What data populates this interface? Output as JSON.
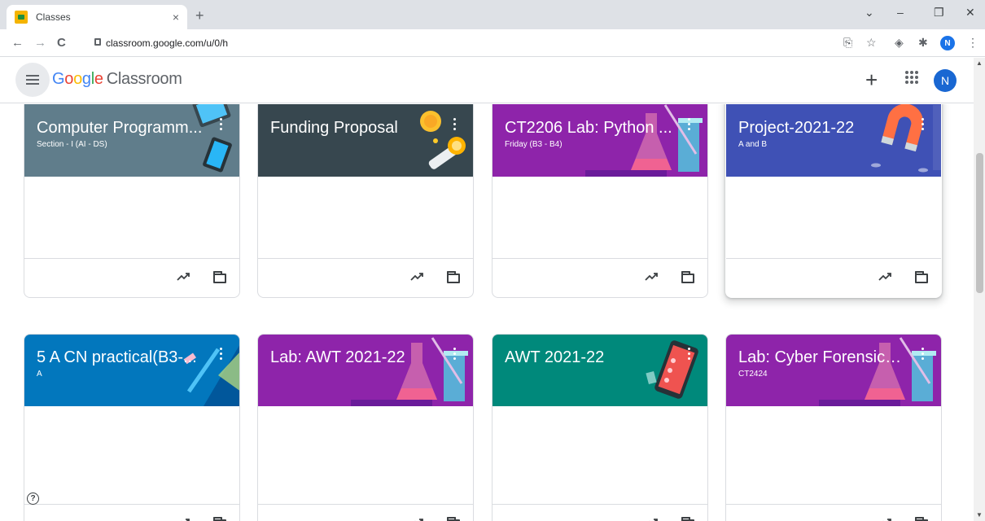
{
  "browser": {
    "tab_title": "Classes",
    "tab_close": "×",
    "new_tab": "+",
    "url": "classroom.google.com/u/0/h",
    "profile_initial": "N",
    "back": "←",
    "forward": "→",
    "reload": "C",
    "minimize": "–",
    "restore": "❐",
    "close": "✕",
    "tab_search": "⌄",
    "share": "⎘",
    "star": "☆",
    "extension": "◈",
    "puzzle": "✱",
    "kebab": "⋮"
  },
  "header": {
    "brand_google": [
      "G",
      "o",
      "o",
      "g",
      "l",
      "e"
    ],
    "brand_product": "Classroom",
    "add": "+",
    "user_initial": "N"
  },
  "classes": [
    {
      "title": "Computer Programm...",
      "section": "Section - I (AI - DS)",
      "color": "#607d8b"
    },
    {
      "title": "Funding Proposal",
      "section": "",
      "color": "#37474f"
    },
    {
      "title": "CT2206 Lab: Python ...",
      "section": "Friday (B3 - B4)",
      "color": "#8e24aa"
    },
    {
      "title": "Project-2021-22",
      "section": "A and B",
      "color": "#3f51b5"
    },
    {
      "title": "5 A CN practical(B3-...",
      "section": "A",
      "color": "#0277bd"
    },
    {
      "title": "Lab: AWT 2021-22",
      "section": "",
      "color": "#8e24aa"
    },
    {
      "title": "AWT 2021-22",
      "section": "",
      "color": "#00897b"
    },
    {
      "title": "Lab: Cyber Forensics ...",
      "section": "CT2424",
      "color": "#8e24aa"
    }
  ],
  "help": "?"
}
